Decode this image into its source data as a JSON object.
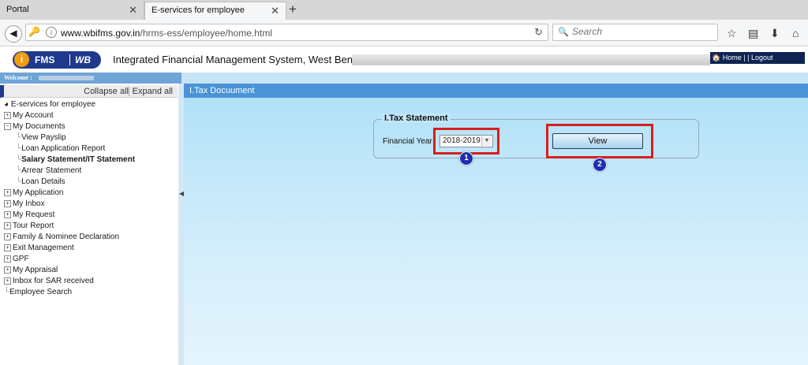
{
  "browser": {
    "tabs": [
      {
        "title": "Portal"
      },
      {
        "title": "E-services for employee"
      }
    ],
    "new_tab": "+",
    "url": {
      "host": "www.wbifms.gov.in",
      "path": "/hrms-ess/employee/home.html"
    },
    "search_placeholder": "Search"
  },
  "header": {
    "logo_i": "i",
    "logo_fms": "FMS",
    "logo_wb": "WB",
    "title": "Integrated Financial Management System, West Bengal",
    "nav": {
      "home": "Home",
      "sep": "| |",
      "logout": "Logout"
    }
  },
  "welcome": {
    "label": "Welcome :"
  },
  "sidebar": {
    "collapse_all": "Collapse all",
    "expand_all": "Expand all",
    "root": "E-services for employee",
    "items": [
      {
        "label": "My Account",
        "sign": "+"
      },
      {
        "label": "My Documents",
        "sign": "−"
      },
      {
        "label": "View Payslip"
      },
      {
        "label": "Loan Application Report"
      },
      {
        "label": "Salary Statement/IT Statement"
      },
      {
        "label": "Arrear Statement"
      },
      {
        "label": "Loan Details"
      },
      {
        "label": "My Application",
        "sign": "+"
      },
      {
        "label": "My Inbox",
        "sign": "+"
      },
      {
        "label": "My Request",
        "sign": "+"
      },
      {
        "label": "Tour Report",
        "sign": "+"
      },
      {
        "label": "Family & Nominee Declaration",
        "sign": "+"
      },
      {
        "label": "Exit Management",
        "sign": "+"
      },
      {
        "label": "GPF",
        "sign": "+"
      },
      {
        "label": "My Appraisal",
        "sign": "+"
      },
      {
        "label": "Inbox for SAR received",
        "sign": "+"
      },
      {
        "label": "Employee Search"
      }
    ]
  },
  "main": {
    "panel_title": "I.Tax Docuument",
    "section_title": "I.Tax Statement",
    "financial_year_label": "Financial Year",
    "financial_year_value": "2018-2019",
    "view_button": "View"
  },
  "annotations": {
    "marker1": "1",
    "marker2": "2",
    "highlight_color": "#d81e1e",
    "marker_color": "#1c2fb0"
  },
  "colors": {
    "panel_header": "#4a93d6",
    "logo_bg": "#1f3a8c",
    "topnav_bg": "#0d2453"
  }
}
